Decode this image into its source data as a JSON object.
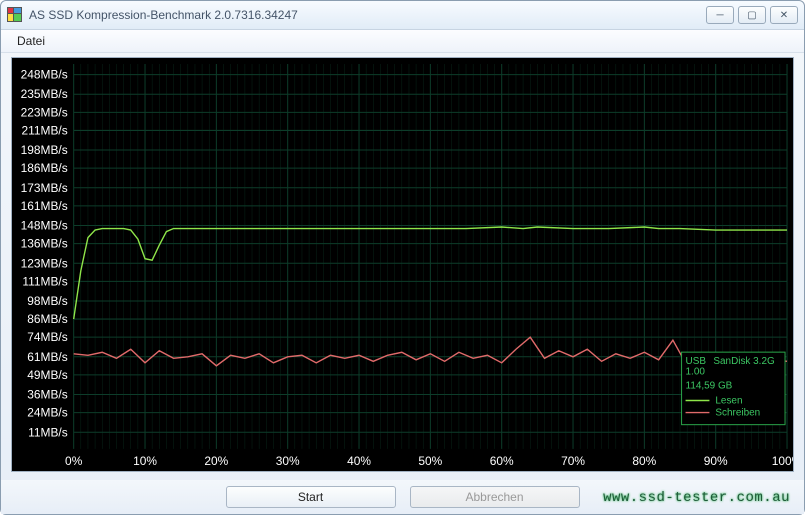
{
  "window": {
    "title": "AS SSD Kompression-Benchmark 2.0.7316.34247",
    "minimize_glyph": "─",
    "maximize_glyph": "▢",
    "close_glyph": "✕"
  },
  "menu": {
    "file": "Datei"
  },
  "footer": {
    "start_label": "Start",
    "cancel_label": "Abbrechen"
  },
  "watermark": "www.ssd-tester.com.au",
  "info_box": {
    "line1_left": "USB",
    "line1_right": "SanDisk 3.2G",
    "line2": "1.00",
    "line3": "114,59 GB",
    "legend_read": "Lesen",
    "legend_write": "Schreiben"
  },
  "colors": {
    "read_series": "#8fe64a",
    "write_series": "#e06a6a",
    "grid": "#0d3d2a",
    "axis_text": "#ffffff",
    "chart_bg": "#000000",
    "info_border": "#2aa54a",
    "info_text": "#3cc763"
  },
  "chart_data": {
    "type": "line",
    "xlabel": "",
    "ylabel": "",
    "x_unit": "%",
    "y_unit": "MB/s",
    "xlim": [
      0,
      100
    ],
    "ylim": [
      0,
      255
    ],
    "x_ticks_pct": [
      0,
      10,
      20,
      30,
      40,
      50,
      60,
      70,
      80,
      90,
      100
    ],
    "y_ticks_mb": [
      11,
      24,
      36,
      49,
      61,
      74,
      86,
      98,
      111,
      123,
      136,
      148,
      161,
      173,
      186,
      198,
      211,
      223,
      235,
      248
    ],
    "series": [
      {
        "name": "Lesen",
        "color_key": "read_series",
        "points": [
          {
            "x": 0,
            "y": 86
          },
          {
            "x": 1,
            "y": 118
          },
          {
            "x": 2,
            "y": 140
          },
          {
            "x": 3,
            "y": 145
          },
          {
            "x": 4,
            "y": 146
          },
          {
            "x": 5,
            "y": 146
          },
          {
            "x": 6,
            "y": 146
          },
          {
            "x": 7,
            "y": 146
          },
          {
            "x": 8,
            "y": 145
          },
          {
            "x": 9,
            "y": 139
          },
          {
            "x": 10,
            "y": 126
          },
          {
            "x": 11,
            "y": 125
          },
          {
            "x": 12,
            "y": 135
          },
          {
            "x": 13,
            "y": 144
          },
          {
            "x": 14,
            "y": 146
          },
          {
            "x": 15,
            "y": 146
          },
          {
            "x": 20,
            "y": 146
          },
          {
            "x": 25,
            "y": 146
          },
          {
            "x": 30,
            "y": 146
          },
          {
            "x": 35,
            "y": 146
          },
          {
            "x": 40,
            "y": 146
          },
          {
            "x": 45,
            "y": 146
          },
          {
            "x": 50,
            "y": 146
          },
          {
            "x": 55,
            "y": 146
          },
          {
            "x": 60,
            "y": 147
          },
          {
            "x": 63,
            "y": 146
          },
          {
            "x": 65,
            "y": 147
          },
          {
            "x": 70,
            "y": 146
          },
          {
            "x": 75,
            "y": 146
          },
          {
            "x": 80,
            "y": 147
          },
          {
            "x": 82,
            "y": 146
          },
          {
            "x": 85,
            "y": 146
          },
          {
            "x": 90,
            "y": 145
          },
          {
            "x": 95,
            "y": 145
          },
          {
            "x": 100,
            "y": 145
          }
        ]
      },
      {
        "name": "Schreiben",
        "color_key": "write_series",
        "points": [
          {
            "x": 0,
            "y": 63
          },
          {
            "x": 2,
            "y": 62
          },
          {
            "x": 4,
            "y": 64
          },
          {
            "x": 6,
            "y": 60
          },
          {
            "x": 8,
            "y": 66
          },
          {
            "x": 10,
            "y": 57
          },
          {
            "x": 12,
            "y": 65
          },
          {
            "x": 14,
            "y": 60
          },
          {
            "x": 16,
            "y": 61
          },
          {
            "x": 18,
            "y": 63
          },
          {
            "x": 20,
            "y": 55
          },
          {
            "x": 22,
            "y": 62
          },
          {
            "x": 24,
            "y": 60
          },
          {
            "x": 26,
            "y": 63
          },
          {
            "x": 28,
            "y": 57
          },
          {
            "x": 30,
            "y": 61
          },
          {
            "x": 32,
            "y": 62
          },
          {
            "x": 34,
            "y": 57
          },
          {
            "x": 36,
            "y": 62
          },
          {
            "x": 38,
            "y": 60
          },
          {
            "x": 40,
            "y": 62
          },
          {
            "x": 42,
            "y": 58
          },
          {
            "x": 44,
            "y": 62
          },
          {
            "x": 46,
            "y": 64
          },
          {
            "x": 48,
            "y": 59
          },
          {
            "x": 50,
            "y": 63
          },
          {
            "x": 52,
            "y": 58
          },
          {
            "x": 54,
            "y": 64
          },
          {
            "x": 56,
            "y": 60
          },
          {
            "x": 58,
            "y": 62
          },
          {
            "x": 60,
            "y": 57
          },
          {
            "x": 62,
            "y": 66
          },
          {
            "x": 64,
            "y": 74
          },
          {
            "x": 66,
            "y": 60
          },
          {
            "x": 68,
            "y": 65
          },
          {
            "x": 70,
            "y": 61
          },
          {
            "x": 72,
            "y": 66
          },
          {
            "x": 74,
            "y": 58
          },
          {
            "x": 76,
            "y": 63
          },
          {
            "x": 78,
            "y": 60
          },
          {
            "x": 80,
            "y": 64
          },
          {
            "x": 82,
            "y": 59
          },
          {
            "x": 84,
            "y": 72
          },
          {
            "x": 86,
            "y": 55
          },
          {
            "x": 88,
            "y": 63
          },
          {
            "x": 90,
            "y": 58
          },
          {
            "x": 92,
            "y": 52
          },
          {
            "x": 94,
            "y": 61
          },
          {
            "x": 96,
            "y": 57
          },
          {
            "x": 98,
            "y": 59
          },
          {
            "x": 100,
            "y": 58
          }
        ]
      }
    ]
  }
}
